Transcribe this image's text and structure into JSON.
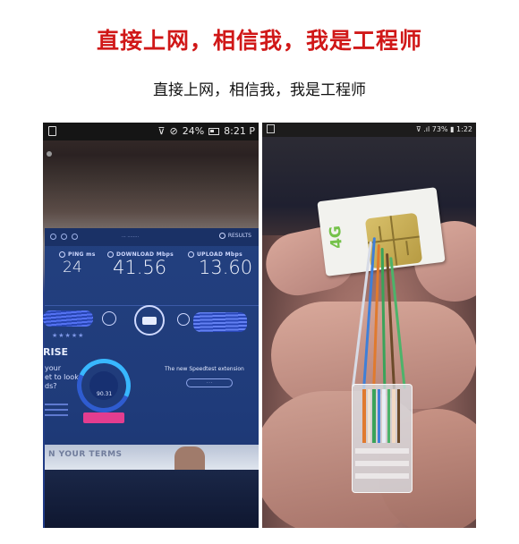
{
  "header": {
    "headline_red": "直接上网，相信我，我是工程师",
    "headline_black": "直接上网，相信我，我是工程师"
  },
  "left_photo": {
    "status_bar": {
      "battery": "24%",
      "time": "8:21 P"
    },
    "speedtest": {
      "results_label": "RESULTS",
      "ping_label": "PING",
      "ping_unit": "ms",
      "ping_value": "24",
      "download_label": "DOWNLOAD",
      "download_unit": "Mbps",
      "download_value": "41.56",
      "upload_label": "UPLOAD",
      "upload_unit": "Mbps",
      "upload_value": "13.60",
      "side_heading": "RISE",
      "side_lines": [
        "your",
        "et to look",
        "ds?"
      ],
      "gauge_value": "90.31",
      "ad_text": "The new Speedtest extension",
      "banner_text": "N YOUR TERMS"
    }
  },
  "right_photo": {
    "status_bar": {
      "battery": "73%",
      "time": "1:22"
    },
    "sim_label": "4G"
  },
  "colors": {
    "headline_red": "#d01818",
    "speedtest_blue": "#1f3b7a",
    "sim_green": "#75c24a"
  }
}
